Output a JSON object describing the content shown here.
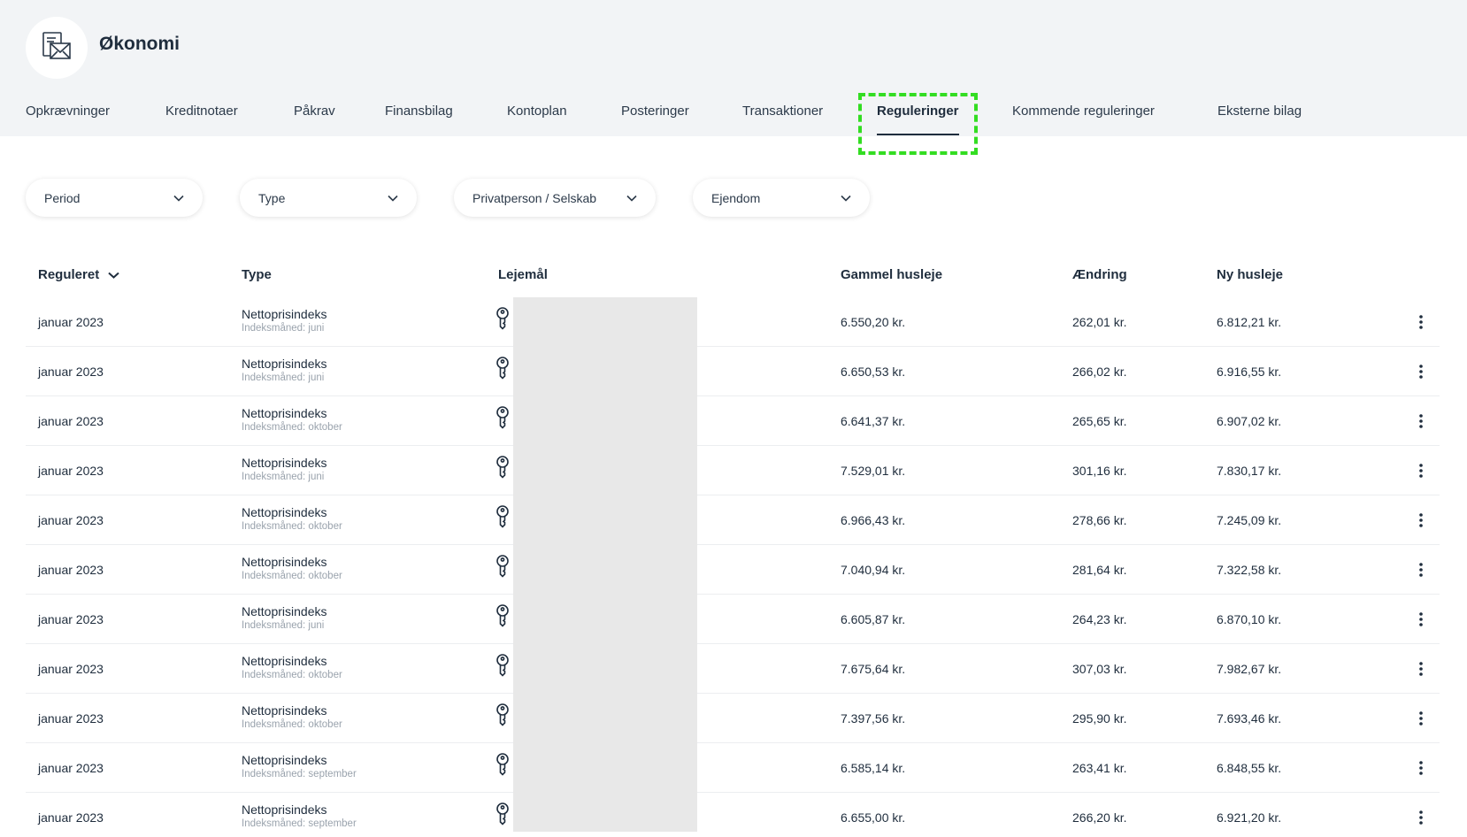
{
  "app": {
    "title": "Økonomi",
    "icon": "envelope-document-icon"
  },
  "tabs": [
    {
      "label": "Opkrævninger",
      "active": false
    },
    {
      "label": "Kreditnotaer",
      "active": false
    },
    {
      "label": "Påkrav",
      "active": false
    },
    {
      "label": "Finansbilag",
      "active": false
    },
    {
      "label": "Kontoplan",
      "active": false
    },
    {
      "label": "Posteringer",
      "active": false
    },
    {
      "label": "Transaktioner",
      "active": false
    },
    {
      "label": "Reguleringer",
      "active": true
    },
    {
      "label": "Kommende reguleringer",
      "active": false
    },
    {
      "label": "Eksterne bilag",
      "active": false
    }
  ],
  "filters": [
    {
      "label": "Period",
      "icon": "chevron-down-icon"
    },
    {
      "label": "Type",
      "icon": "chevron-down-icon"
    },
    {
      "label": "Privatperson / Selskab",
      "icon": "chevron-down-icon"
    },
    {
      "label": "Ejendom",
      "icon": "chevron-down-icon"
    }
  ],
  "table": {
    "headers": {
      "reguleret": "Reguleret",
      "type": "Type",
      "lejemaal": "Lejemål",
      "gammel": "Gammel husleje",
      "aendring": "Ændring",
      "ny": "Ny husleje"
    },
    "rows": [
      {
        "date": "januar 2023",
        "type": "Nettoprisindeks",
        "sub": "Indeksmåned: juni",
        "old": "6.550,20 kr.",
        "change": "262,01 kr.",
        "new": "6.812,21 kr."
      },
      {
        "date": "januar 2023",
        "type": "Nettoprisindeks",
        "sub": "Indeksmåned: juni",
        "old": "6.650,53 kr.",
        "change": "266,02 kr.",
        "new": "6.916,55 kr."
      },
      {
        "date": "januar 2023",
        "type": "Nettoprisindeks",
        "sub": "Indeksmåned: oktober",
        "old": "6.641,37 kr.",
        "change": "265,65 kr.",
        "new": "6.907,02 kr."
      },
      {
        "date": "januar 2023",
        "type": "Nettoprisindeks",
        "sub": "Indeksmåned: juni",
        "old": "7.529,01 kr.",
        "change": "301,16 kr.",
        "new": "7.830,17 kr."
      },
      {
        "date": "januar 2023",
        "type": "Nettoprisindeks",
        "sub": "Indeksmåned: oktober",
        "old": "6.966,43 kr.",
        "change": "278,66 kr.",
        "new": "7.245,09 kr."
      },
      {
        "date": "januar 2023",
        "type": "Nettoprisindeks",
        "sub": "Indeksmåned: oktober",
        "old": "7.040,94 kr.",
        "change": "281,64 kr.",
        "new": "7.322,58 kr."
      },
      {
        "date": "januar 2023",
        "type": "Nettoprisindeks",
        "sub": "Indeksmåned: juni",
        "old": "6.605,87 kr.",
        "change": "264,23 kr.",
        "new": "6.870,10 kr."
      },
      {
        "date": "januar 2023",
        "type": "Nettoprisindeks",
        "sub": "Indeksmåned: oktober",
        "old": "7.675,64 kr.",
        "change": "307,03 kr.",
        "new": "7.982,67 kr."
      },
      {
        "date": "januar 2023",
        "type": "Nettoprisindeks",
        "sub": "Indeksmåned: oktober",
        "old": "7.397,56 kr.",
        "change": "295,90 kr.",
        "new": "7.693,46 kr."
      },
      {
        "date": "januar 2023",
        "type": "Nettoprisindeks",
        "sub": "Indeksmåned: september",
        "old": "6.585,14 kr.",
        "change": "263,41 kr.",
        "new": "6.848,55 kr."
      },
      {
        "date": "januar 2023",
        "type": "Nettoprisindeks",
        "sub": "Indeksmåned: september",
        "old": "6.655,00 kr.",
        "change": "266,20 kr.",
        "new": "6.921,20 kr."
      }
    ]
  },
  "colors": {
    "highlight": "#33dd22",
    "text": "#1f2d3d",
    "header_bg": "#f2f4f6"
  }
}
